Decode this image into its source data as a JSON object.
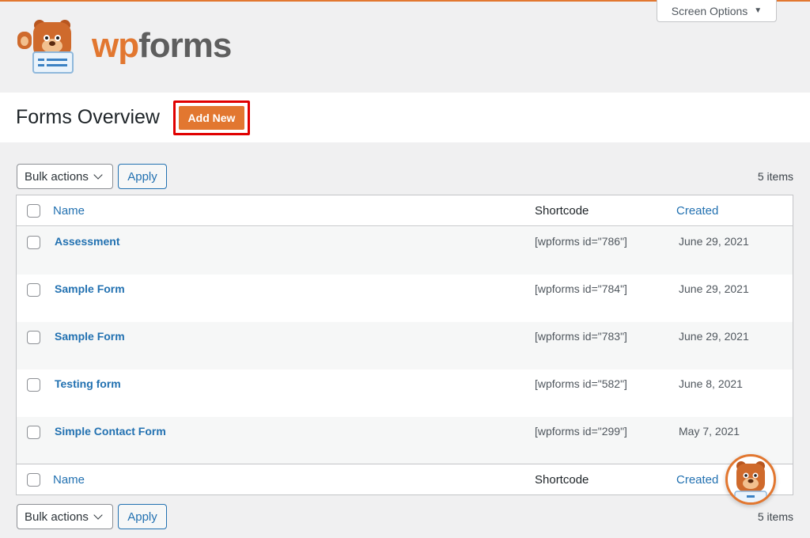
{
  "brand": {
    "wp": "wp",
    "forms": "forms",
    "accent_color": "#e27730"
  },
  "screen_options": {
    "label": "Screen Options"
  },
  "header": {
    "title": "Forms Overview",
    "add_new_label": "Add New"
  },
  "tablenav_top": {
    "bulk_actions": "Bulk actions",
    "apply": "Apply",
    "items_count": "5 items"
  },
  "tablenav_bottom": {
    "bulk_actions": "Bulk actions",
    "apply": "Apply",
    "items_count": "5 items"
  },
  "table": {
    "columns": {
      "name": "Name",
      "shortcode": "Shortcode",
      "created": "Created"
    },
    "rows": [
      {
        "name": "Assessment",
        "shortcode": "[wpforms id=\"786\"]",
        "created": "June 29, 2021"
      },
      {
        "name": "Sample Form",
        "shortcode": "[wpforms id=\"784\"]",
        "created": "June 29, 2021"
      },
      {
        "name": "Sample Form",
        "shortcode": "[wpforms id=\"783\"]",
        "created": "June 29, 2021"
      },
      {
        "name": "Testing form",
        "shortcode": "[wpforms id=\"582\"]",
        "created": "June 8, 2021"
      },
      {
        "name": "Simple Contact Form",
        "shortcode": "[wpforms id=\"299\"]",
        "created": "May 7, 2021"
      }
    ]
  }
}
